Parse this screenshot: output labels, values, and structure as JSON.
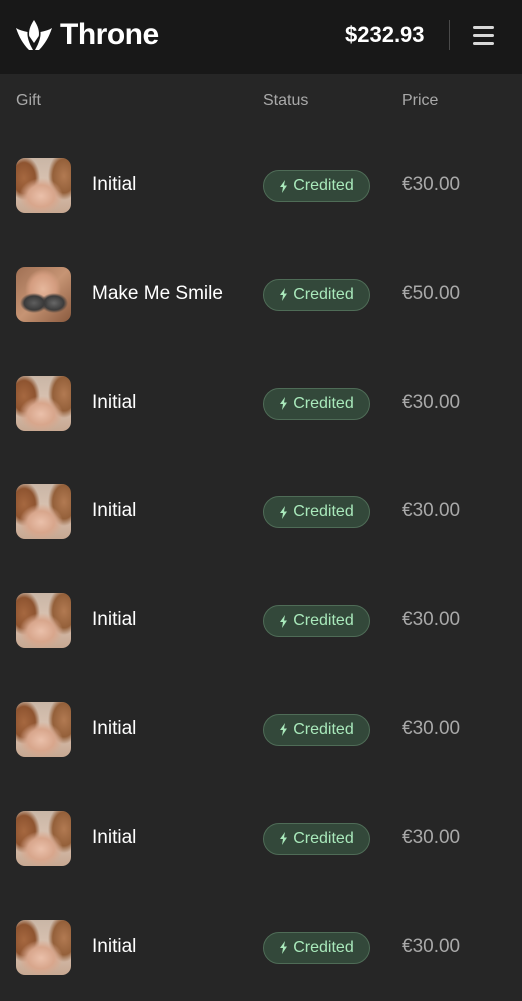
{
  "header": {
    "brand": "Throne",
    "balance": "$232.93",
    "icons": {
      "logo": "throne-crown-logo-icon",
      "menu": "hamburger-menu-icon"
    }
  },
  "columns": {
    "gift": "Gift",
    "status": "Status",
    "price": "Price"
  },
  "colors": {
    "header_bg": "#181818",
    "page_bg": "#262626",
    "badge_bg": "#33483a",
    "badge_text": "#a9e9bb"
  },
  "rows": [
    {
      "name": "Initial",
      "status": "Credited",
      "price": "€30.00"
    },
    {
      "name": "Make Me Smile",
      "status": "Credited",
      "price": "€50.00"
    },
    {
      "name": "Initial",
      "status": "Credited",
      "price": "€30.00"
    },
    {
      "name": "Initial",
      "status": "Credited",
      "price": "€30.00"
    },
    {
      "name": "Initial",
      "status": "Credited",
      "price": "€30.00"
    },
    {
      "name": "Initial",
      "status": "Credited",
      "price": "€30.00"
    },
    {
      "name": "Initial",
      "status": "Credited",
      "price": "€30.00"
    },
    {
      "name": "Initial",
      "status": "Credited",
      "price": "€30.00"
    }
  ]
}
